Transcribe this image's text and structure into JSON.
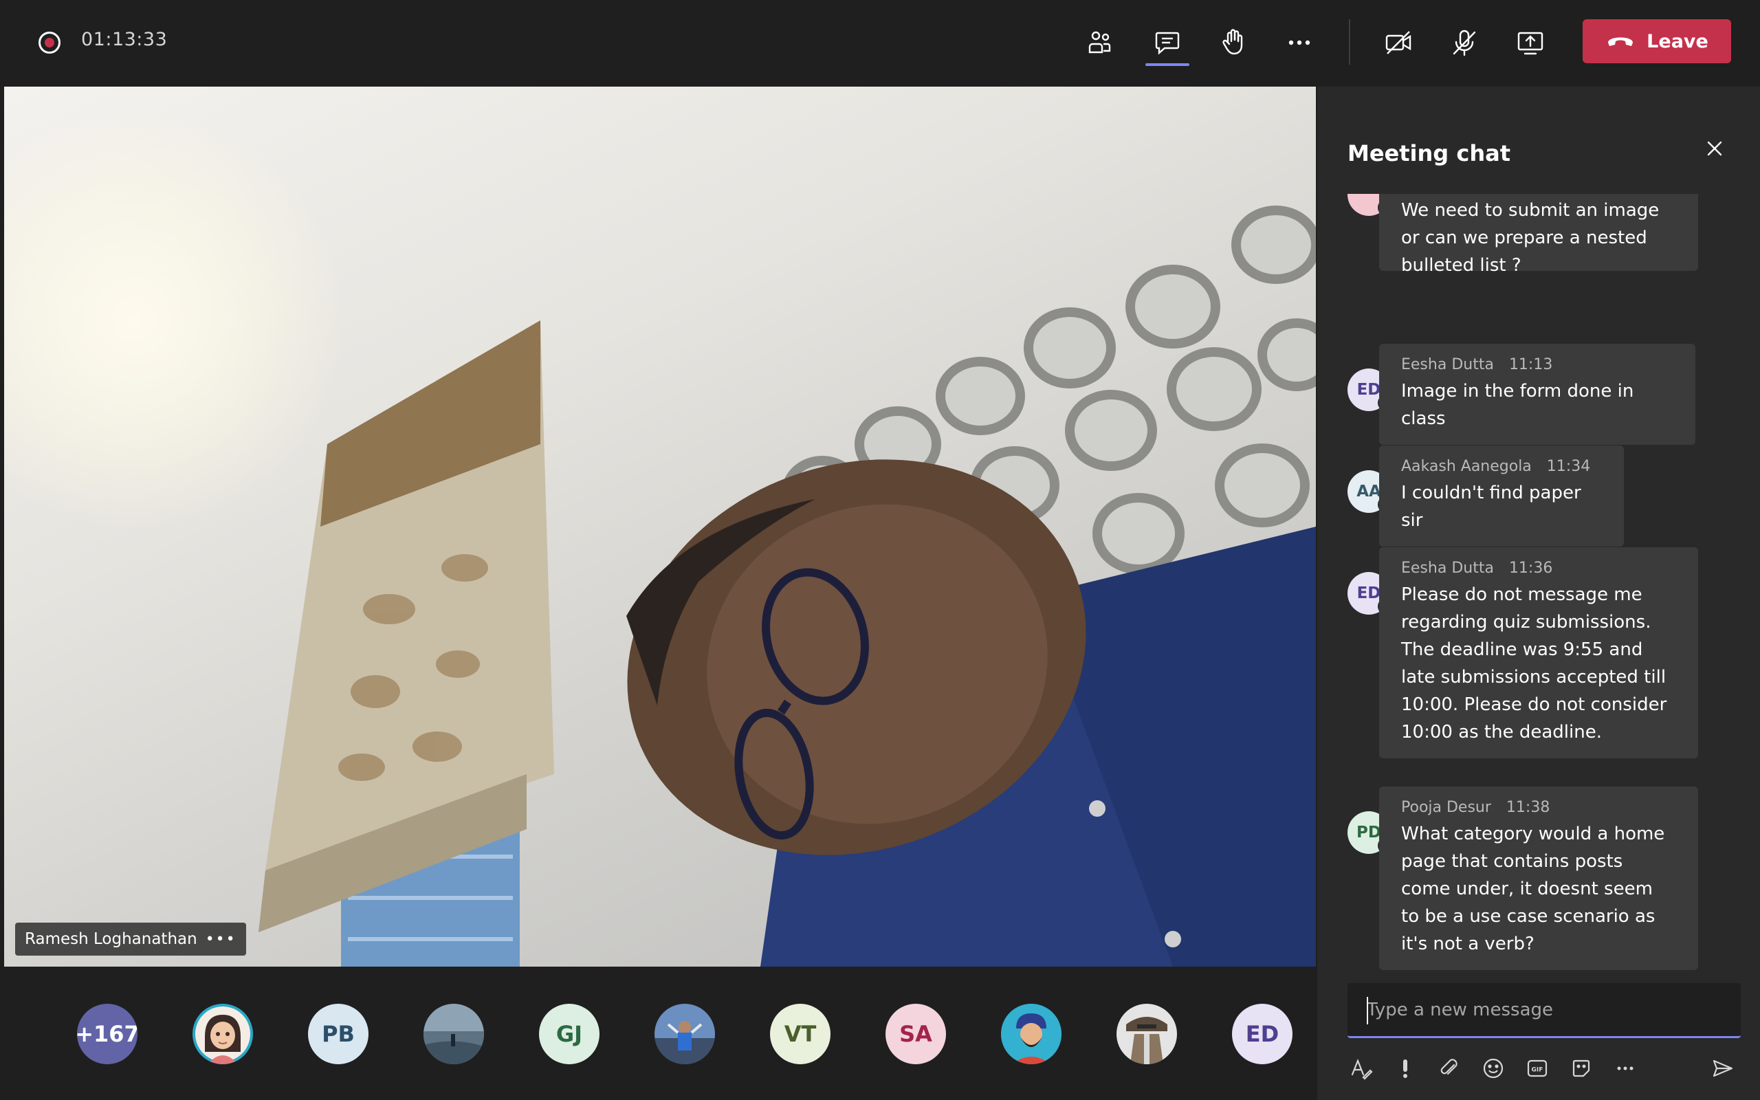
{
  "recording": {
    "timer": "01:13:33"
  },
  "toolbar": {
    "icons": [
      "people-icon",
      "chat-icon",
      "raise-hand-icon",
      "more-icon",
      "camera-off-icon",
      "mic-off-icon",
      "share-screen-icon"
    ],
    "leave_label": "Leave",
    "colors": {
      "leave": "#c4314b",
      "accent": "#7f85f5"
    }
  },
  "video": {
    "participant_name": "Ramesh Loghanathan",
    "more": "•••"
  },
  "chat": {
    "title": "Meeting chat",
    "messages": [
      {
        "initials": "",
        "author": "",
        "time": "",
        "text": "We need to submit an image or can we prepare a nested bulleted list ?"
      },
      {
        "initials": "ED",
        "author": "Eesha Dutta",
        "time": "11:13",
        "text": "Image in the form done in class"
      },
      {
        "initials": "AA",
        "author": "Aakash Aanegola",
        "time": "11:34",
        "text": "I couldn't find paper sir"
      },
      {
        "initials": "ED",
        "author": "Eesha Dutta",
        "time": "11:36",
        "text": "Please do not message me regarding quiz submissions. The deadline was 9:55 and late submissions accepted till 10:00. Please do not consider 10:00 as the deadline."
      },
      {
        "initials": "PD",
        "author": "Pooja Desur",
        "time": "11:38",
        "text": "What category would a home page that contains posts come under, it doesnt seem to be a use case scenario as it's not a verb?"
      }
    ],
    "compose_placeholder": "Type a new message",
    "compose_tools": [
      "format-icon",
      "important-icon",
      "attach-icon",
      "emoji-icon",
      "gif-icon",
      "sticker-icon",
      "more-icon",
      "send-icon"
    ]
  },
  "participants": [
    {
      "label": "+167",
      "kind": "overflow"
    },
    {
      "label": "",
      "kind": "photo"
    },
    {
      "label": "PB",
      "kind": "initials"
    },
    {
      "label": "",
      "kind": "photo"
    },
    {
      "label": "GJ",
      "kind": "initials"
    },
    {
      "label": "",
      "kind": "photo"
    },
    {
      "label": "VT",
      "kind": "initials"
    },
    {
      "label": "SA",
      "kind": "initials"
    },
    {
      "label": "",
      "kind": "photo"
    },
    {
      "label": "",
      "kind": "photo"
    },
    {
      "label": "ED",
      "kind": "initials"
    }
  ]
}
